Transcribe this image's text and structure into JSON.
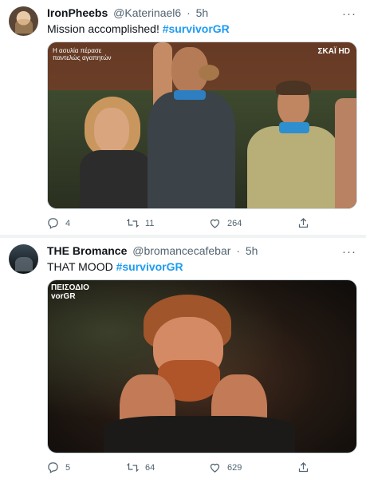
{
  "tweets": [
    {
      "name": "IronPheebs",
      "handle": "@Katerinael6",
      "time": "5h",
      "text": "Mission accomplished!",
      "hashtag": "#survivorGR",
      "video_bug_left": "Η ασυλία πέρασε\nπαντελώς αγαπητών",
      "video_bug_right": "ΣΚΑΪ HD",
      "actions": {
        "replies": "4",
        "retweets": "11",
        "likes": "264"
      }
    },
    {
      "name": "THE Bromance",
      "handle": "@bromancecafebar",
      "time": "5h",
      "text": "THAT MOOD",
      "hashtag": "#survivorGR",
      "video_overlay_line1": "ΠΕΙΣΟΔΙΟ",
      "video_overlay_line2": "vorGR",
      "actions": {
        "replies": "5",
        "retweets": "64",
        "likes": "629"
      }
    }
  ],
  "icons": {
    "reply": "reply-icon",
    "retweet": "retweet-icon",
    "like": "heart-icon",
    "share": "share-icon",
    "more": "more-icon"
  },
  "colors": {
    "hashtag": "#1d9bf0",
    "meta": "#536471"
  }
}
